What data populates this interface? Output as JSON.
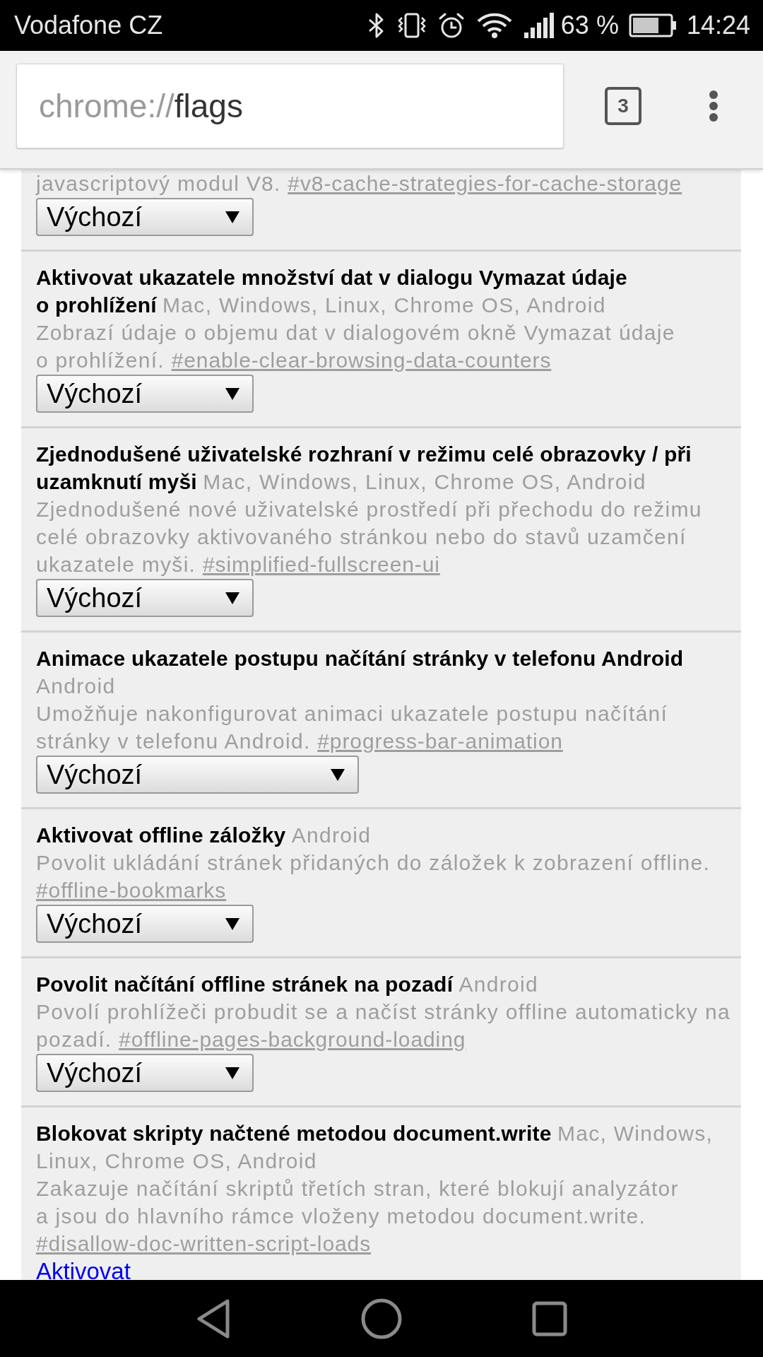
{
  "status_bar": {
    "carrier": "Vodafone CZ",
    "battery": "63 %",
    "time": "14:24"
  },
  "toolbar": {
    "url": {
      "scheme": "chrome://",
      "path": "flags"
    },
    "tab_count": "3"
  },
  "flags": [
    {
      "description": "javascriptový modul V8.",
      "flag": "#v8-cache-strategies-for-cache-storage",
      "control": {
        "kind": "select",
        "value": "Výchozí"
      }
    },
    {
      "title": "Aktivovat ukazatele množství dat v dialogu Vymazat údaje o prohlížení",
      "platforms": "Mac, Windows, Linux, Chrome OS, Android",
      "description": "Zobrazí údaje o objemu dat v dialogovém okně Vymazat údaje o prohlížení.",
      "flag": "#enable-clear-browsing-data-counters",
      "control": {
        "kind": "select",
        "value": "Výchozí"
      }
    },
    {
      "title": "Zjednodušené uživatelské rozhraní v režimu celé obrazovky / při uzamknutí myši",
      "platforms": "Mac, Windows, Linux, Chrome OS, Android",
      "description": "Zjednodušené nové uživatelské prostředí při přechodu do režimu celé obrazovky aktivovaného stránkou nebo do stavů uzamčení ukazatele myši.",
      "flag": "#simplified-fullscreen-ui",
      "control": {
        "kind": "select",
        "value": "Výchozí"
      }
    },
    {
      "title": "Animace ukazatele postupu načítání stránky v telefonu Android",
      "platforms": "Android",
      "description": "Umožňuje nakonfigurovat animaci ukazatele postupu načítání stránky v telefonu Android.",
      "flag": "#progress-bar-animation",
      "control": {
        "kind": "select_wide",
        "value": "Výchozí"
      }
    },
    {
      "title": "Aktivovat offline záložky",
      "platforms": "Android",
      "description": "Povolit ukládání stránek přidaných do záložek k zobrazení offline.",
      "flag": "#offline-bookmarks",
      "control": {
        "kind": "select",
        "value": "Výchozí"
      }
    },
    {
      "title": "Povolit načítání offline stránek na pozadí",
      "platforms": "Android",
      "description": "Povolí prohlížeči probudit se a načíst stránky offline automaticky na pozadí.",
      "flag": "#offline-pages-background-loading",
      "control": {
        "kind": "select",
        "value": "Výchozí"
      }
    },
    {
      "title": "Blokovat skripty načtené metodou document.write",
      "platforms": "Mac, Windows, Linux, Chrome OS, Android",
      "description": "Zakazuje načítání skriptů třetích stran, které blokují analyzátor a jsou do hlavního rámce vloženy metodou document.write.",
      "flag": "#disallow-doc-written-script-loads",
      "control": {
        "kind": "link",
        "label": "Aktivovat"
      }
    }
  ]
}
